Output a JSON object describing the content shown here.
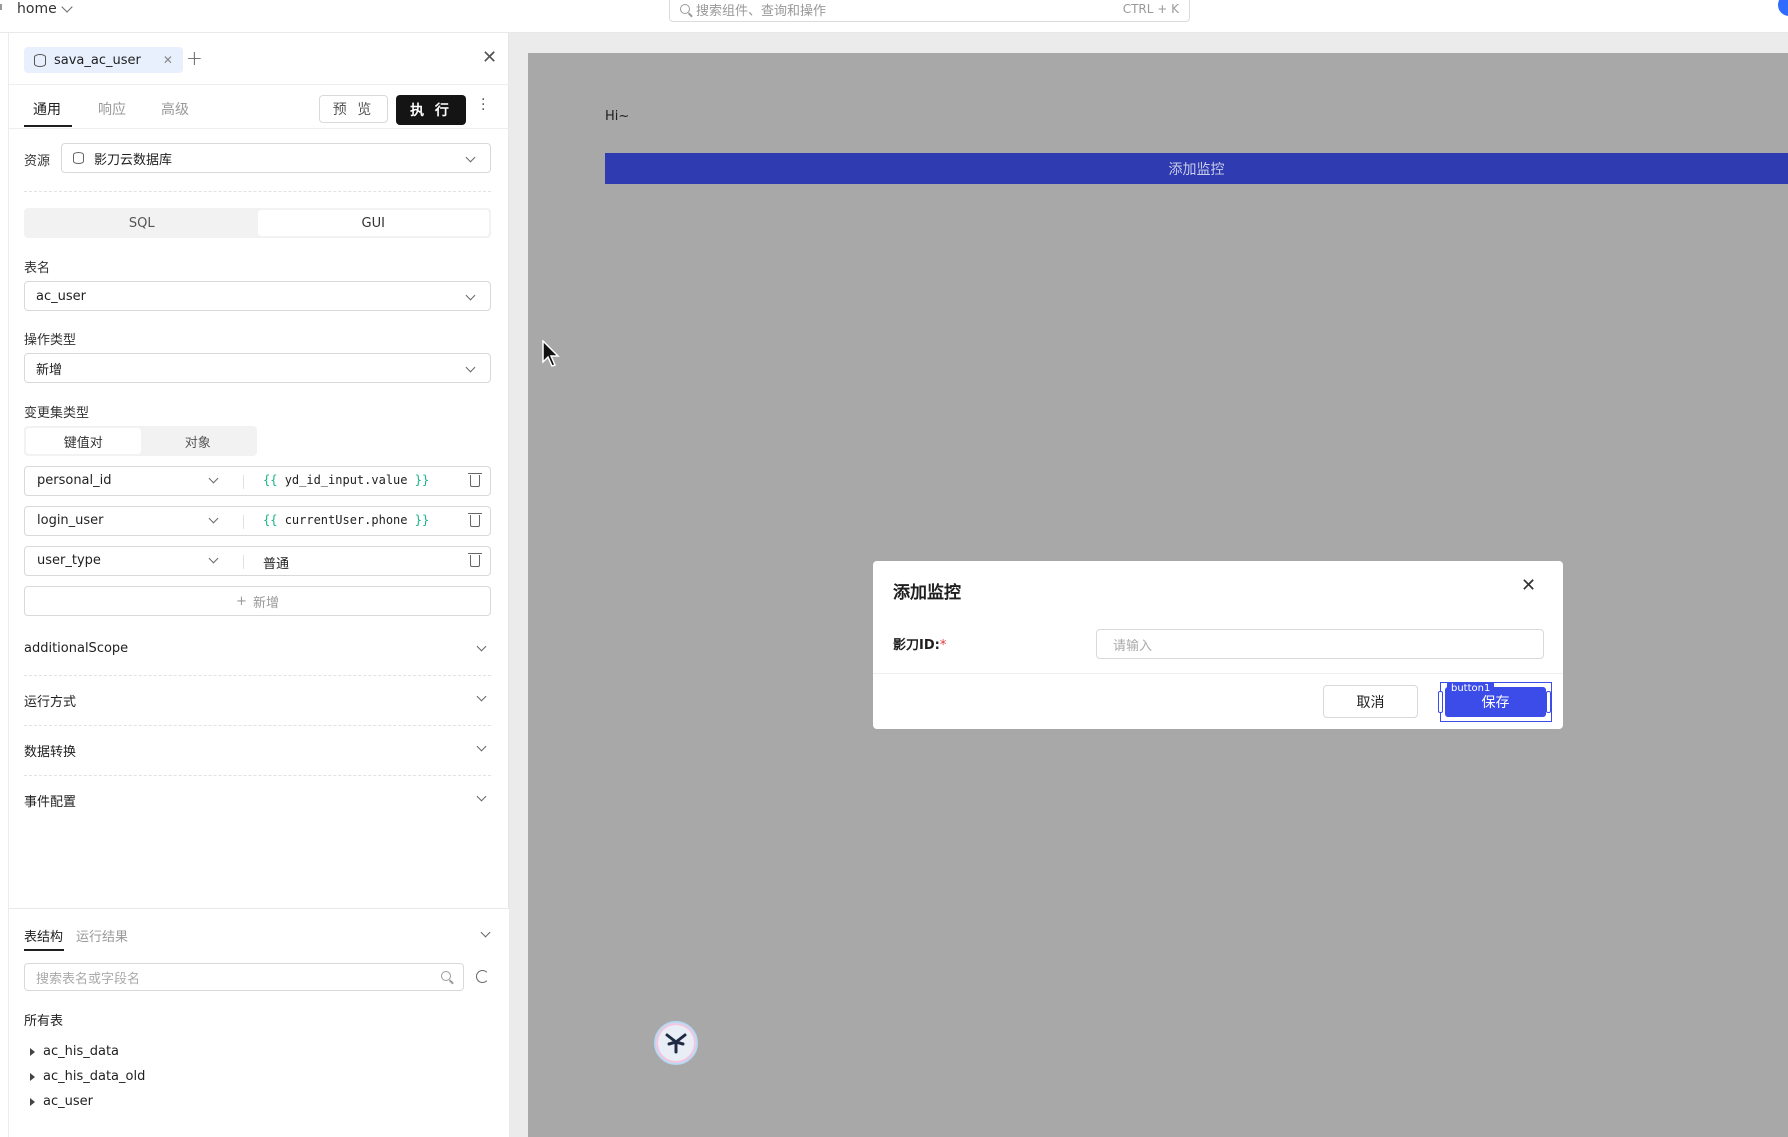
{
  "topbar": {
    "breadcrumb": "home",
    "search_placeholder": "搜索组件、查询和操作",
    "search_shortcut": "CTRL + K"
  },
  "query_panel": {
    "query_tab": "sava_ac_user",
    "subtabs": [
      "通用",
      "响应",
      "高级"
    ],
    "preview_label": "预 览",
    "execute_label": "执 行",
    "resource_label": "资源",
    "resource_value": "影刀云数据库",
    "mode_tabs": [
      "SQL",
      "GUI"
    ],
    "active_mode": "GUI",
    "table_label": "表名",
    "table_value": "ac_user",
    "op_label": "操作类型",
    "op_value": "新增",
    "changeset_label": "变更集类型",
    "changeset_tabs": [
      "键值对",
      "对象"
    ],
    "kv_rows": [
      {
        "key": "personal_id",
        "value": "yd_id_input.value",
        "templated": true
      },
      {
        "key": "login_user",
        "value": "currentUser.phone",
        "templated": true
      },
      {
        "key": "user_type",
        "value": "普通",
        "templated": false
      }
    ],
    "add_label": "新增",
    "collapsibles": [
      "additionalScope",
      "运行方式",
      "数据转换",
      "事件配置"
    ]
  },
  "bottom_panel": {
    "tabs": [
      "表结构",
      "运行结果"
    ],
    "search_placeholder": "搜索表名或字段名",
    "all_tables_label": "所有表",
    "tables": [
      "ac_his_data",
      "ac_his_data_old",
      "ac_user"
    ]
  },
  "canvas": {
    "greeting": "Hi~",
    "add_monitor_button": "添加监控"
  },
  "modal": {
    "title": "添加监控",
    "field_label": "影刀ID:",
    "required_mark": "*",
    "field_placeholder": "请输入",
    "cancel_label": "取消",
    "save_label": "保存",
    "save_component_tag": "button1"
  },
  "colors": {
    "primary": "#3b4ce8",
    "monitor_button": "#2f3bb0",
    "execute_button": "#141414",
    "template_brace": "#18b58a",
    "overlay": "#a8a8a8"
  }
}
